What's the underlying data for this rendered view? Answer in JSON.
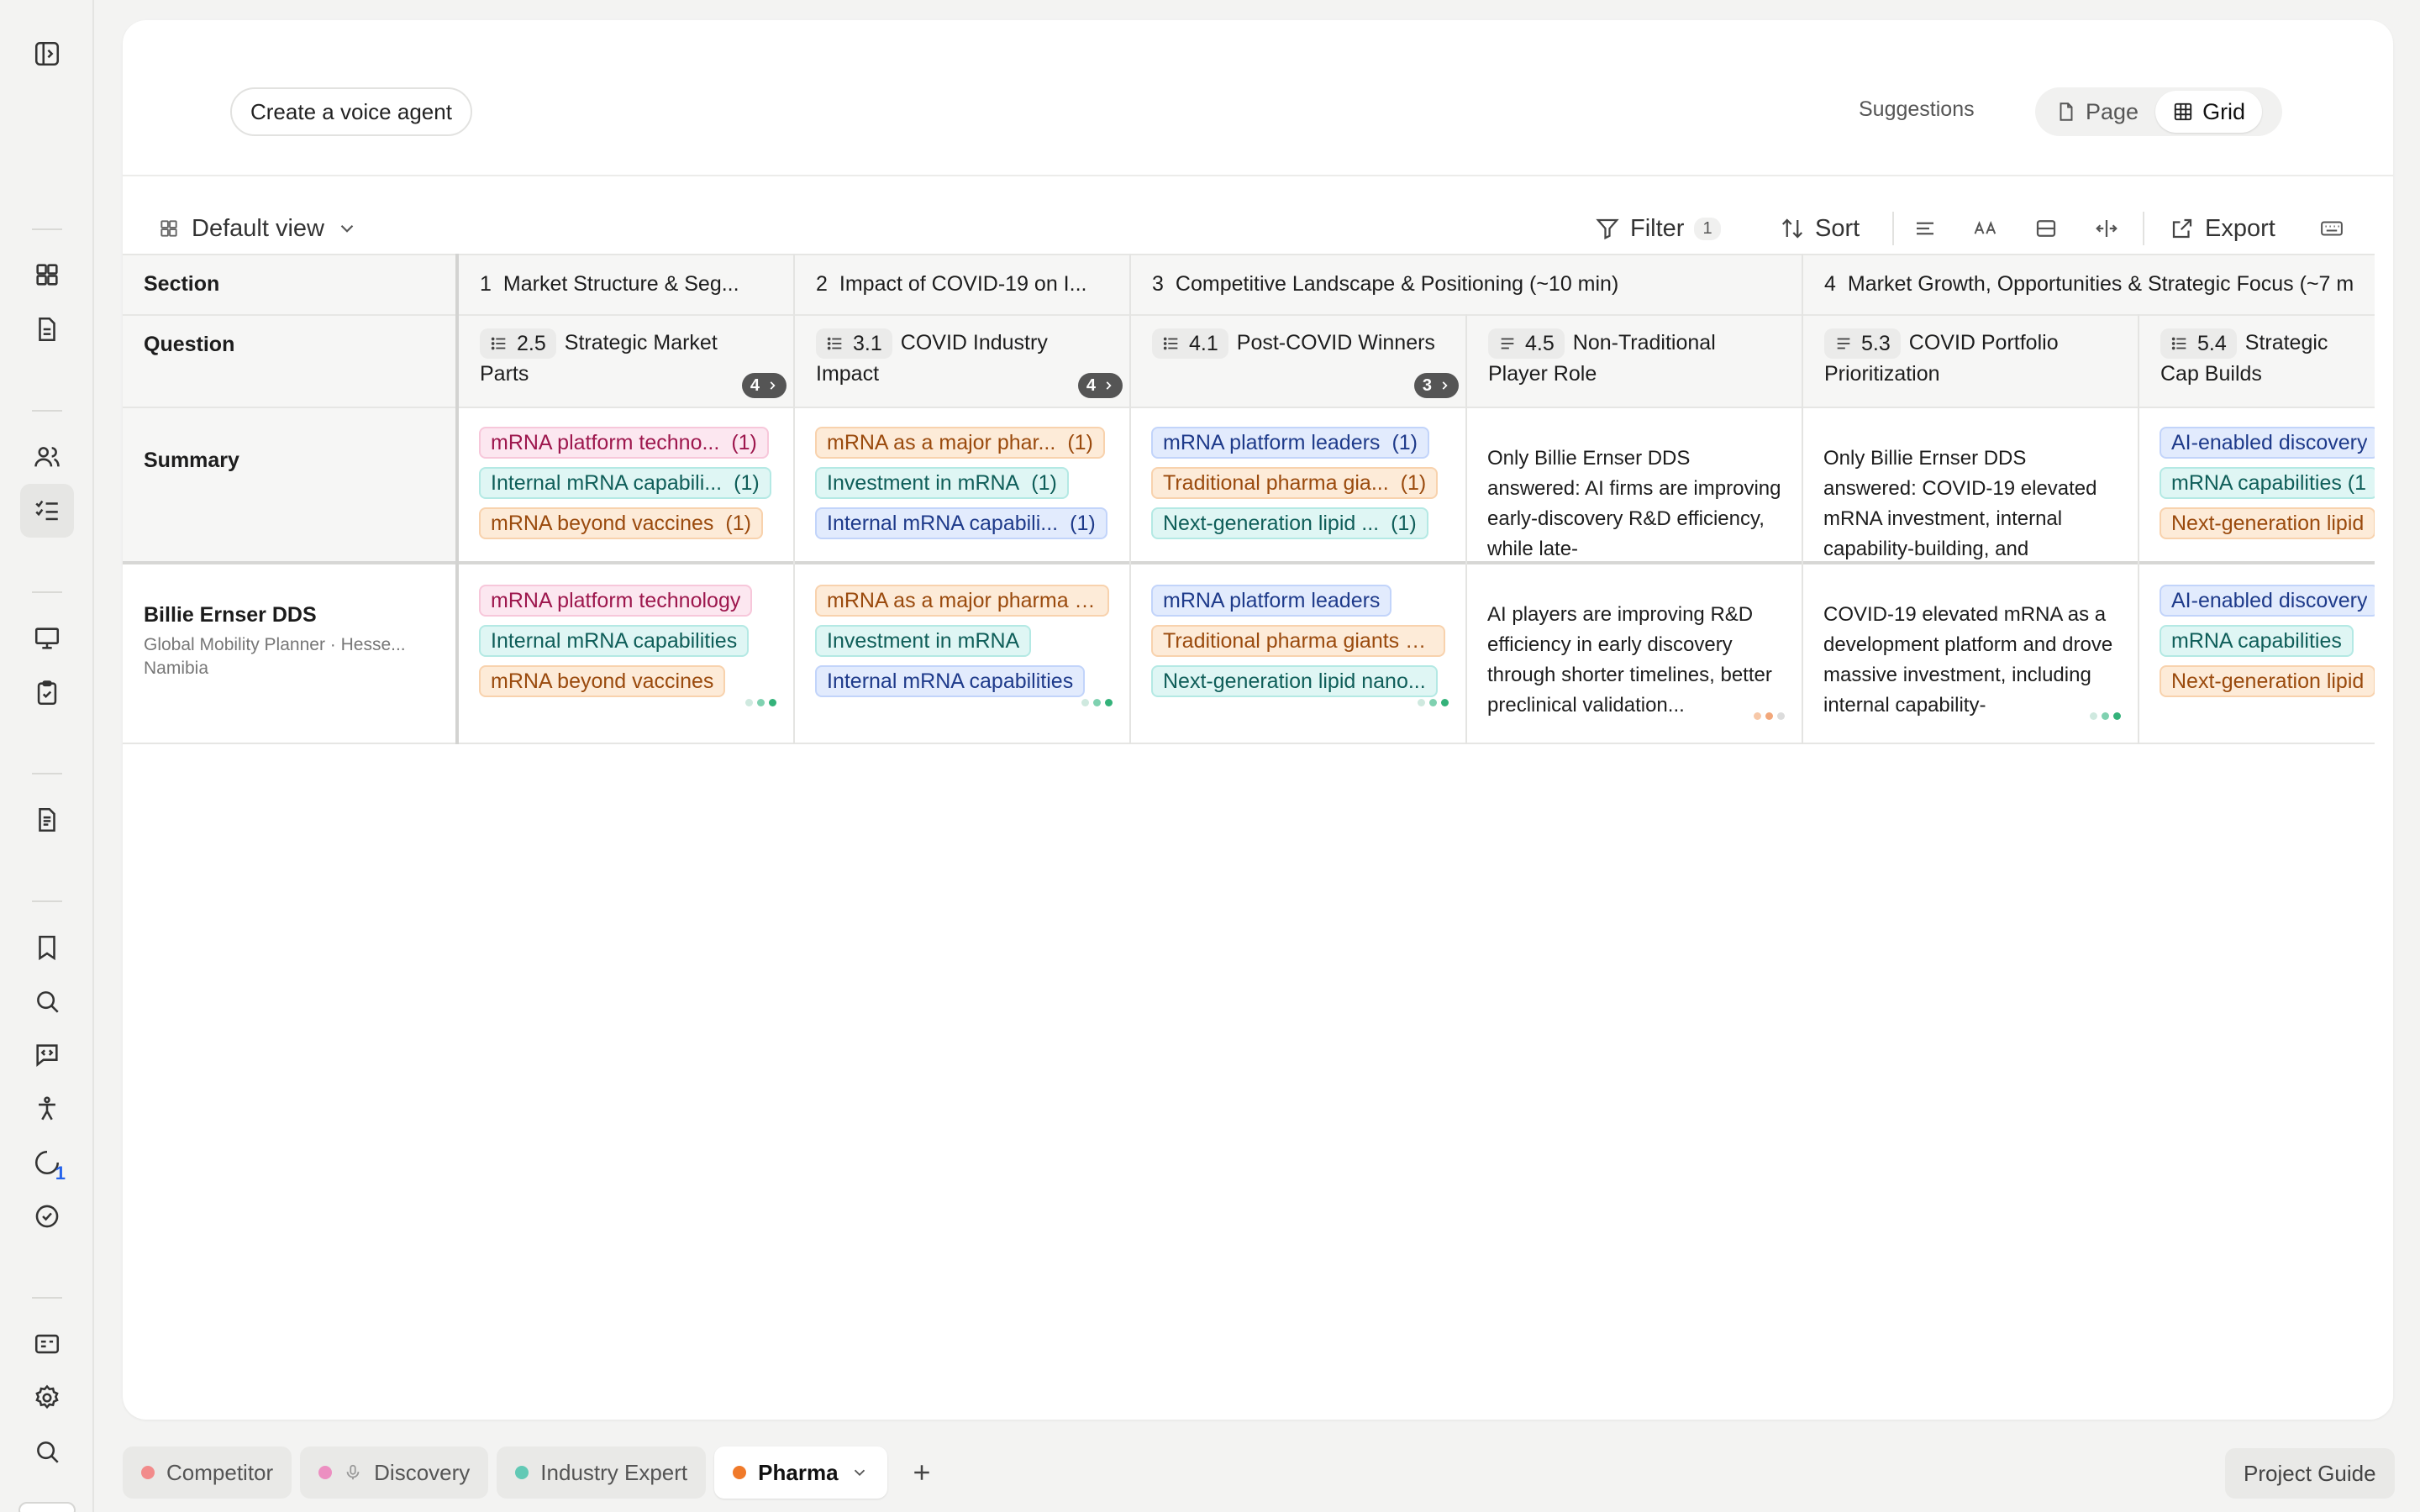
{
  "topbar": {
    "voice_agent_button": "Create a voice agent",
    "suggestions_label": "Suggestions",
    "view_toggle": {
      "page_label": "Page",
      "grid_label": "Grid",
      "selected": "Grid"
    }
  },
  "toolbar": {
    "view_label": "Default view",
    "filter_label": "Filter",
    "filter_count": "1",
    "sort_label": "Sort",
    "export_label": "Export"
  },
  "grid": {
    "row_labels": {
      "section": "Section",
      "question": "Question",
      "summary": "Summary"
    },
    "sections": [
      {
        "num": "1",
        "title": "Market Structure & Seg..."
      },
      {
        "num": "2",
        "title": "Impact of COVID-19 on I..."
      },
      {
        "num": "3",
        "title": "Competitive Landscape & Positioning (~10 min)"
      },
      {
        "num": "4",
        "title": "Market Growth, Opportunities & Strategic Focus (~7 m"
      }
    ],
    "questions": [
      {
        "code": "2.5",
        "title": "Strategic Market Parts",
        "count": "4"
      },
      {
        "code": "3.1",
        "title": "COVID Industry Impact",
        "count": "4"
      },
      {
        "code": "4.1",
        "title": "Post-COVID Winners",
        "count": "3"
      },
      {
        "code": "4.5",
        "title": "Non-Traditional Player Role"
      },
      {
        "code": "5.3",
        "title": "COVID Portfolio Prioritization"
      },
      {
        "code": "5.4",
        "title": "Strategic Cap Builds"
      }
    ],
    "summary": {
      "q1": [
        {
          "text": "mRNA platform techno...",
          "count": "(1)"
        },
        {
          "text": "Internal mRNA capabili...",
          "count": "(1)"
        },
        {
          "text": "mRNA beyond vaccines",
          "count": "(1)"
        }
      ],
      "q2": [
        {
          "text": "mRNA as a major phar...",
          "count": "(1)"
        },
        {
          "text": "Investment in mRNA",
          "count": "(1)"
        },
        {
          "text": "Internal mRNA capabili...",
          "count": "(1)"
        }
      ],
      "q3": [
        {
          "text": "mRNA platform leaders",
          "count": "(1)"
        },
        {
          "text": "Traditional pharma gia...",
          "count": "(1)"
        },
        {
          "text": "Next-generation lipid ...",
          "count": "(1)"
        }
      ],
      "q4_text": "Only Billie Ernser DDS answered: AI firms are improving early-discovery R&D efficiency, while late-",
      "q5_text": "Only Billie Ernser DDS answered: COVID-19 elevated mRNA investment, internal capability-building, and",
      "q6": [
        {
          "text": "AI-enabled discovery"
        },
        {
          "text": "mRNA capabilities (1"
        },
        {
          "text": "Next-generation lipid"
        }
      ]
    },
    "respondent": {
      "name": "Billie Ernser DDS",
      "meta": "Global Mobility Planner · Hesse...",
      "country": "Namibia",
      "q1": [
        "mRNA platform technology",
        "Internal mRNA capabilities",
        "mRNA beyond vaccines"
      ],
      "q2": [
        "mRNA as a major pharma d...",
        "Investment in mRNA",
        "Internal mRNA capabilities"
      ],
      "q3": [
        "mRNA platform leaders",
        "Traditional pharma giants b...",
        "Next-generation lipid nano..."
      ],
      "q4_text": "AI players are improving R&D efficiency in early discovery through shorter timelines, better preclinical validation...",
      "q5_text": "COVID-19 elevated mRNA as a development platform and drove massive investment, including internal capability-",
      "q6": [
        "AI-enabled discovery",
        "mRNA capabilities",
        "Next-generation lipid"
      ]
    }
  },
  "rail": {
    "notification_badge": "1"
  },
  "tabs": [
    {
      "label": "Competitor",
      "color": "#f28b8b"
    },
    {
      "label": "Discovery",
      "color": "#ec8fc1"
    },
    {
      "label": "Industry Expert",
      "color": "#62c9b5"
    },
    {
      "label": "Pharma",
      "color": "#f07a2a"
    }
  ],
  "project_guide_label": "Project Guide"
}
